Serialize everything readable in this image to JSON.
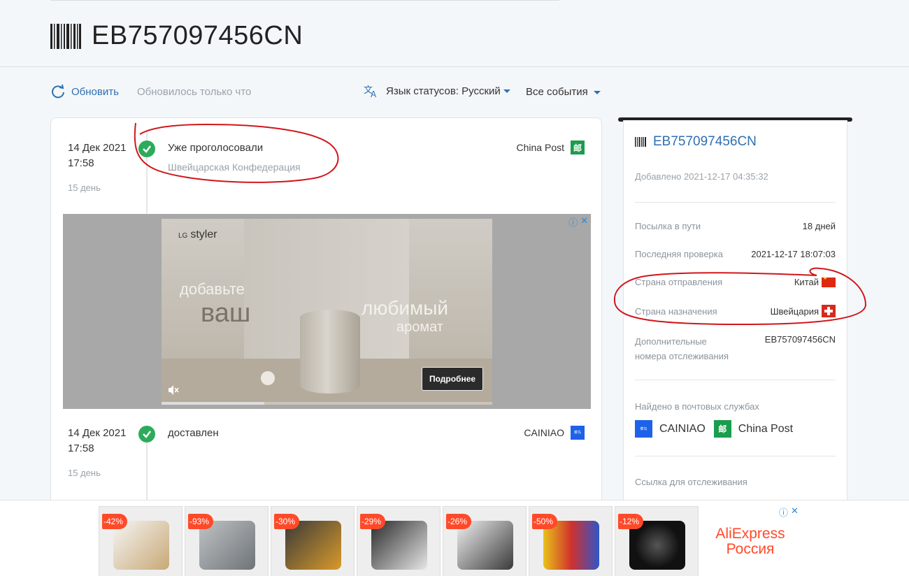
{
  "header": {
    "tracking_number": "EB757097456CN"
  },
  "toolbar": {
    "refresh_label": "Обновить",
    "updated_text": "Обновилось только что",
    "language_label": "Язык статусов: Русский",
    "events_filter": "Все события"
  },
  "events": [
    {
      "date": "14 Дек 2021",
      "time": "17:58",
      "ago": "15 день",
      "status": "Уже проголосовали",
      "location": "Швейцарская Конфедерация",
      "carrier": "China Post"
    },
    {
      "date": "14 Дек 2021",
      "time": "17:58",
      "ago": "15 день",
      "status": "доставлен",
      "location": "",
      "carrier": "CAINIAO"
    }
  ],
  "ad": {
    "brand_small": "LG",
    "brand": "styler",
    "line1": "добавьте",
    "line2": "ваш",
    "line3": "любимый",
    "line4": "аромат",
    "cta": "Подробнее",
    "progress": 0.31
  },
  "sidebar": {
    "tracking_number": "EB757097456CN",
    "added": "Добавлено 2021-12-17 04:35:32",
    "rows": [
      {
        "key": "Посылка в пути",
        "value": "18 дней"
      },
      {
        "key": "Последняя проверка",
        "value": "2021-12-17 18:07:03"
      },
      {
        "key": "Страна отправления",
        "value": "Китай"
      },
      {
        "key": "Страна назначения",
        "value": "Швейцария"
      }
    ],
    "extra_key_line1": "Дополнительные",
    "extra_key_line2": "номера отслеживания",
    "extra_value": "EB757097456CN",
    "found_label": "Найдено в почтовых службах",
    "services": [
      "CAINIAO",
      "China Post"
    ],
    "link_label": "Ссылка для отслеживания"
  },
  "bottom_ad": {
    "discounts": [
      "-42%",
      "-93%",
      "-30%",
      "-29%",
      "-26%",
      "-50%",
      "-12%"
    ],
    "brand_line1": "AliExpress",
    "brand_line2": "Россия"
  },
  "colors": {
    "accent": "#2f6fb1",
    "check_green": "#2dab5c",
    "annotation_red": "#d0161b",
    "sale_orange": "#ff4a2a"
  }
}
